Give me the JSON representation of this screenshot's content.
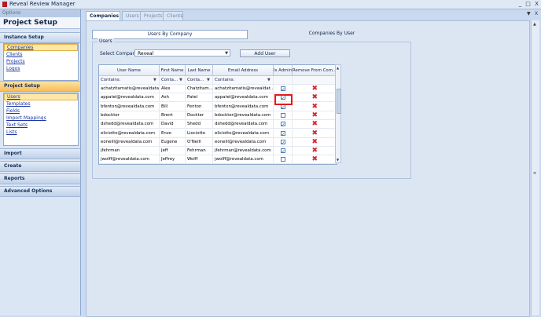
{
  "window": {
    "title": "Reveal Review Manager",
    "controls": [
      "_",
      "□",
      "X"
    ]
  },
  "left_pane": {
    "options_label": "Options",
    "title": "Project Setup",
    "sections": {
      "instance_setup": {
        "label": "Instance Setup",
        "items": [
          "Companies",
          "Clients",
          "Projects",
          "Logos"
        ],
        "selected": "Companies"
      },
      "project_setup": {
        "label": "Project Setup",
        "items": [
          "Users",
          "Templates",
          "Fields",
          "Import Mappings",
          "Text Sets",
          "Lists"
        ],
        "selected": "Users"
      },
      "import": {
        "label": "Import"
      },
      "create": {
        "label": "Create"
      },
      "reports": {
        "label": "Reports"
      },
      "advanced": {
        "label": "Advanced Options"
      }
    }
  },
  "tabs": [
    "Companies",
    "Users",
    "Projects",
    "Clients"
  ],
  "content_controls": {
    "pin": "▼",
    "close": "X"
  },
  "subtabs": {
    "users_by_company": "Users By Company",
    "company_by_user": "Companies By User"
  },
  "users_group": {
    "label": "Users",
    "select_company_label": "Select Company:",
    "select_company_value": "Reveal",
    "add_user_button": "Add User"
  },
  "grid": {
    "headers": [
      "User Name",
      "First Name",
      "Last Name",
      "Email Address",
      "Is Admin",
      "Remove From Com..."
    ],
    "filters": [
      "Contains:",
      "Conta...",
      "Conta...",
      "Contains:"
    ],
    "rows": [
      {
        "user": "achatzitamatis@revealdata...",
        "first": "Alex",
        "last": "Chatzitam...",
        "email": "achatzitamatis@revealdat...",
        "admin": true
      },
      {
        "user": "appatel@revealdata.com",
        "first": "Ash",
        "last": "Patel",
        "email": "appatel@revealdata.com",
        "admin": true
      },
      {
        "user": "bfenton@revealdata.com",
        "first": "Bill",
        "last": "Fenton",
        "email": "bfenton@revealdata.com",
        "admin": true
      },
      {
        "user": "bdockter",
        "first": "Brent",
        "last": "Dockter",
        "email": "bdockter@revealdata.com",
        "admin": false
      },
      {
        "user": "dshedd@revealdata.com",
        "first": "David",
        "last": "Shedd",
        "email": "dshedd@revealdata.com",
        "admin": true
      },
      {
        "user": "eliciotto@revealdata.com",
        "first": "Enzo",
        "last": "Liociotto",
        "email": "eliciotto@revealdata.com",
        "admin": true
      },
      {
        "user": "eoneill@revealdata.com",
        "first": "Eugene",
        "last": "O'Neill",
        "email": "eoneill@revealdata.com",
        "admin": true
      },
      {
        "user": "jfehrman",
        "first": "Jeff",
        "last": "Fehrman",
        "email": "jfehrman@revealdata.com",
        "admin": true
      },
      {
        "user": "jwolff@revealdata.com",
        "first": "Jeffrey",
        "last": "Wolff",
        "email": "jwolff@revealdata.com",
        "admin": false
      }
    ],
    "remove_icon": "✖"
  },
  "colors": {
    "accent": "#f6bd5a",
    "highlight_box": "#e0191e",
    "remove": "#d8262e"
  }
}
